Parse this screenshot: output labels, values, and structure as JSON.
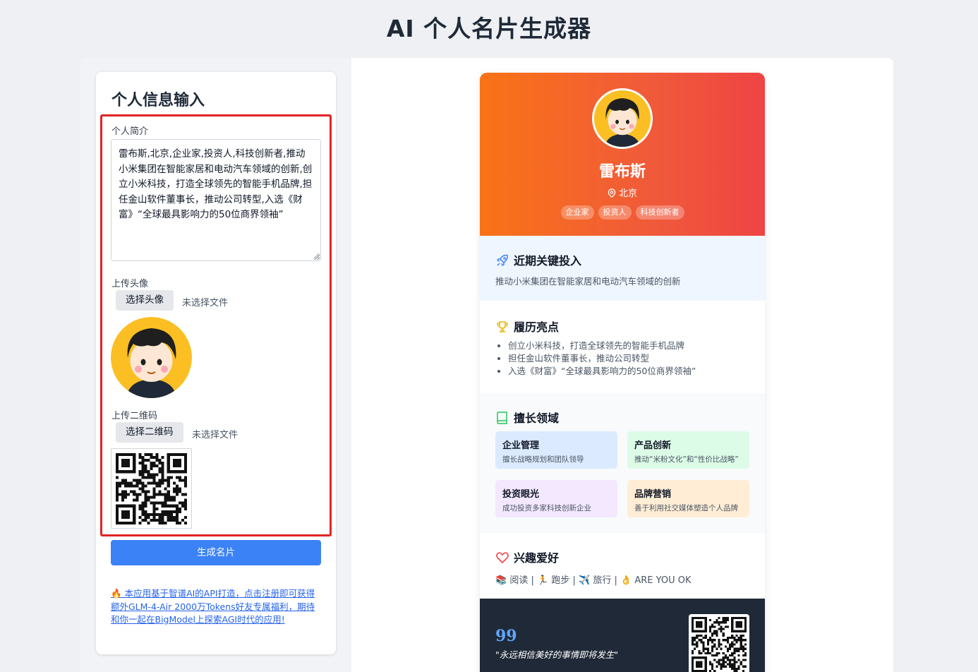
{
  "page": {
    "title": "AI 个人名片生成器"
  },
  "form": {
    "title": "个人信息输入",
    "bio_label": "个人简介",
    "bio_value": "雷布斯,北京,企业家,投资人,科技创新者,推动小米集团在智能家居和电动汽车领域的创新,创立小米科技，打造全球领先的智能手机品牌,担任金山软件董事长，推动公司转型,入选《财富》“全球最具影响力的50位商界领袖”",
    "avatar_label": "上传头像",
    "avatar_button": "选择头像",
    "avatar_status": "未选择文件",
    "qr_label": "上传二维码",
    "qr_button": "选择二维码",
    "qr_status": "未选择文件",
    "generate_button": "生成名片",
    "promo_icon": "🔥",
    "promo_text": "本应用基于智谱AI的API打造，点击注册即可获得额外GLM-4-Air 2000万Tokens好友专属福利，期待和你一起在BigModel上探索AGI时代的应用!"
  },
  "card": {
    "name": "雷布斯",
    "location": "北京",
    "tags": [
      "企业家",
      "投资人",
      "科技创新者"
    ],
    "recent": {
      "title": "近期关键投入",
      "text": "推动小米集团在智能家居和电动汽车领域的创新"
    },
    "resume": {
      "title": "履历亮点",
      "items": [
        "创立小米科技，打造全球领先的智能手机品牌",
        "担任金山软件董事长，推动公司转型",
        "入选《财富》“全球最具影响力的50位商界领袖”"
      ]
    },
    "skills": {
      "title": "擅长领域",
      "items": [
        {
          "title": "企业管理",
          "desc": "擅长战略规划和团队领导"
        },
        {
          "title": "产品创新",
          "desc": "推动“米粉文化”和“性价比战略”"
        },
        {
          "title": "投资眼光",
          "desc": "成功投资多家科技创新企业"
        },
        {
          "title": "品牌营销",
          "desc": "善于利用社交媒体塑造个人品牌"
        }
      ]
    },
    "hobbies": {
      "title": "兴趣爱好",
      "items": [
        {
          "icon": "📚",
          "label": "阅读"
        },
        {
          "icon": "🏃",
          "label": "跑步"
        },
        {
          "icon": "✈️",
          "label": "旅行"
        },
        {
          "icon": "👌",
          "label": "ARE YOU OK"
        }
      ],
      "separator": "|"
    },
    "quote": {
      "mark": "99",
      "text": "\"永远相信美好的事情即将发生\""
    }
  },
  "colors": {
    "accent": "#3b82f6",
    "header_from": "#f97316",
    "header_to": "#ef4444",
    "footer": "#1f2937",
    "highlight": "#e02424"
  },
  "icons": {
    "location": "map-pin-icon",
    "recent": "rocket-icon",
    "resume": "trophy-icon",
    "skills": "book-icon",
    "hobbies": "heart-icon",
    "quote": "quote-icon"
  }
}
